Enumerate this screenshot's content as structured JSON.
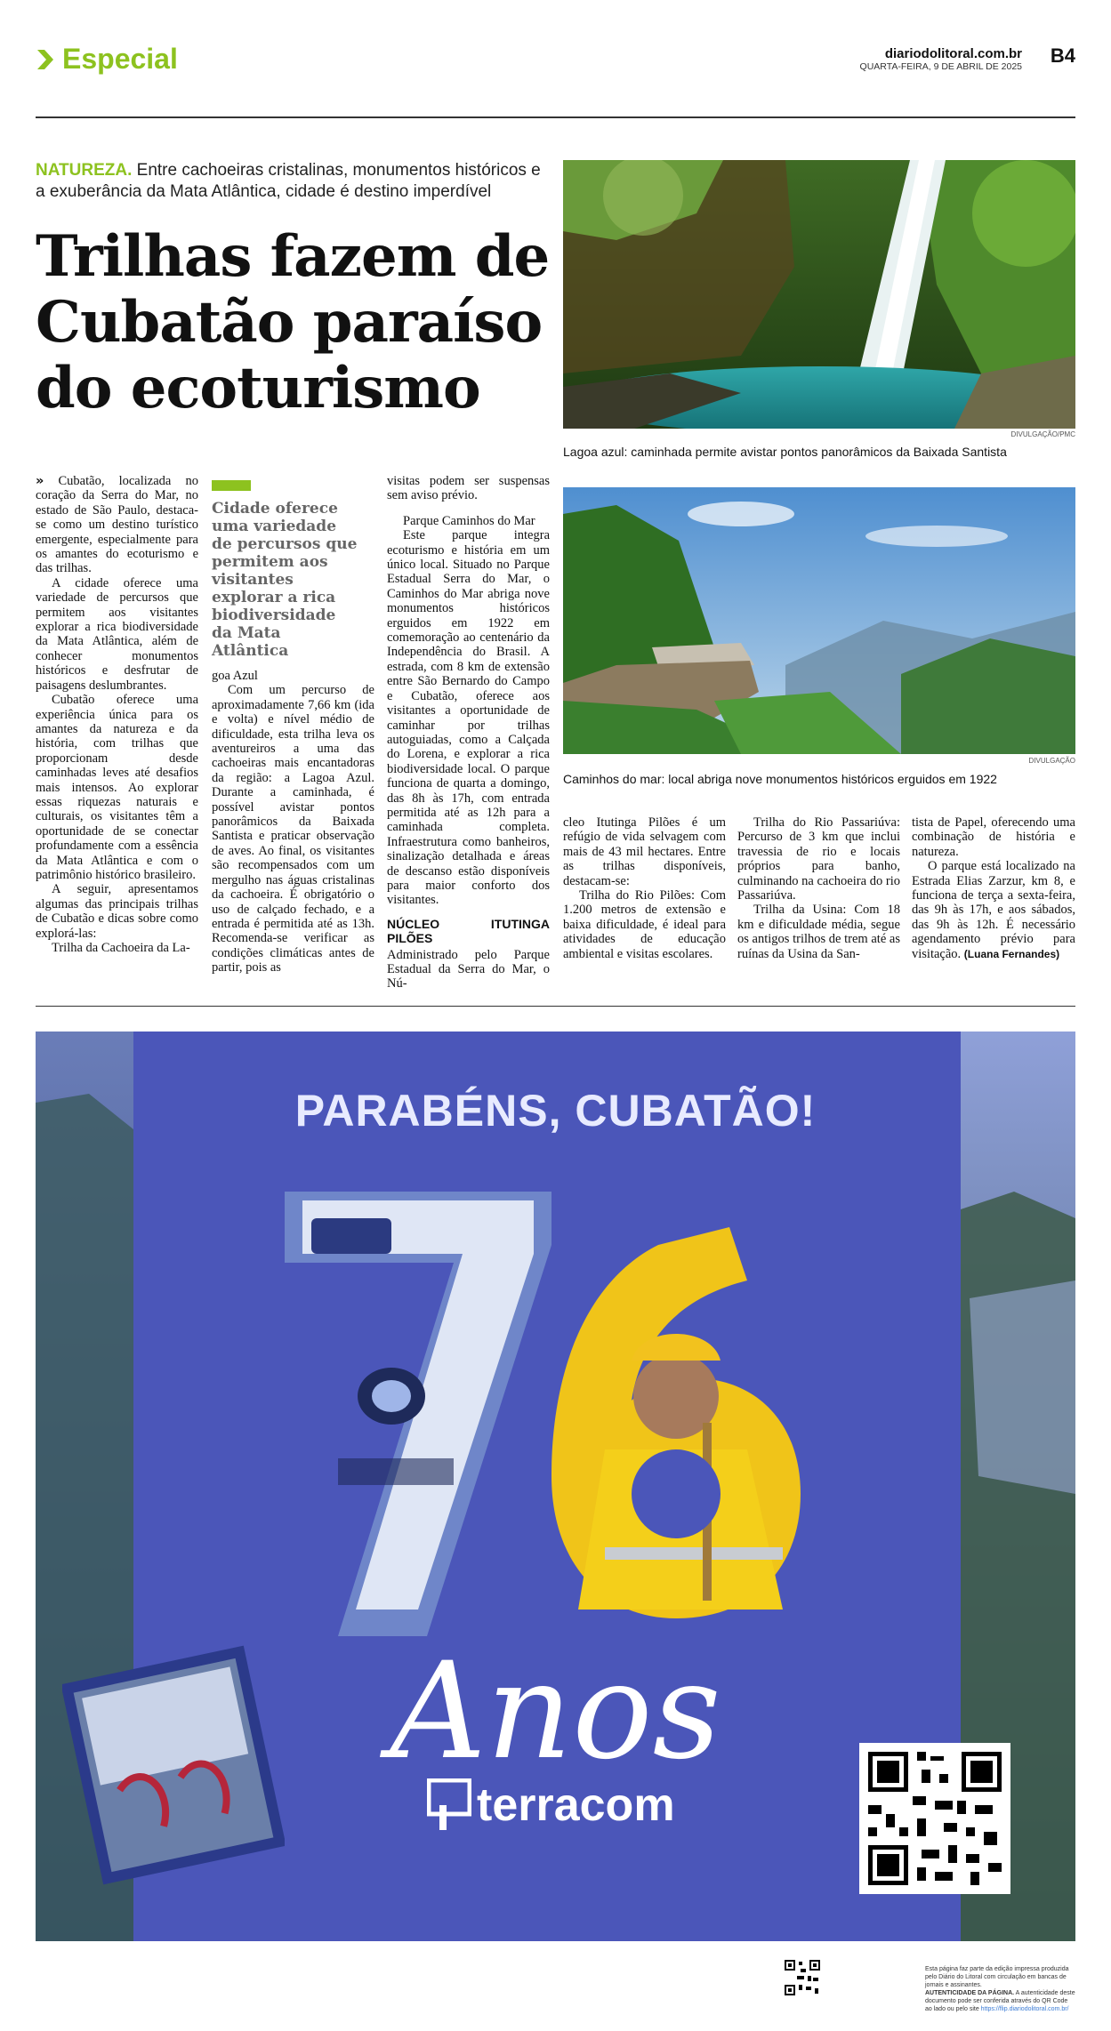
{
  "header": {
    "section": "Especial",
    "site": "diariodolitoral.com.br",
    "date": "QUARTA-FEIRA, 9 DE ABRIL DE 2025",
    "page": "B4"
  },
  "article": {
    "kicker_label": "NATUREZA.",
    "kicker_text": "Entre cachoeiras cristalinas, monumentos históricos e a exuberância da Mata Atlântica, cidade é destino imperdível",
    "headline": "Trilhas fazem de Cubatão paraíso do ecoturismo",
    "pullquote": "Cidade oferece uma variedade de percursos que permitem aos visitantes explorar a rica biodiversidade da Mata Atlântica",
    "col1": [
      "Cubatão, localizada no coração da Serra do Mar, no estado de São Paulo, destaca-se como um destino turístico emergente, especialmente para os amantes do ecoturismo e das trilhas.",
      "A cidade oferece uma variedade de percursos que permitem aos visitantes explorar a rica biodiversidade da Mata Atlântica, além de conhecer monumentos históricos e desfrutar de paisagens deslumbrantes.",
      "Cubatão oferece uma experiência única para os amantes da natureza e da história, com trilhas que proporcionam desde caminhadas leves até desafios mais intensos. Ao explorar essas riquezas naturais e culturais, os visitantes têm a oportunidade de se conectar profundamente com a essência da Mata Atlântica e com o patrimônio histórico brasileiro.",
      "A seguir, apresentamos algumas das principais trilhas de Cubatão e dicas sobre como explorá-las:",
      "Trilha da Cachoeira da La-"
    ],
    "col2": [
      "goa Azul",
      "Com um percurso de aproximadamente 7,66 km (ida e volta) e nível médio de dificuldade, esta trilha leva os aventureiros a uma das cachoeiras mais encantadoras da região: a Lagoa Azul. Durante a caminhada, é possível avistar pontos panorâmicos da Baixada Santista e praticar observação de aves. Ao final, os visitantes são recompensados com um mergulho nas águas cristalinas da cachoeira. É obrigatório o uso de calçado fechado, e a entrada é permitida até as 13h. Recomenda-se verificar as condições climáticas antes de partir, pois as"
    ],
    "col3": [
      "visitas podem ser suspensas sem aviso prévio.",
      "Parque Caminhos do Mar",
      "Este parque integra ecoturismo e história em um único local. Situado no Parque Estadual Serra do Mar, o Caminhos do Mar abriga nove monumentos históricos erguidos em 1922 em comemoração ao centenário da Independência do Brasil. A estrada, com 8 km de extensão entre São Bernardo do Campo e Cubatão, oferece aos visitantes a oportunidade de caminhar por trilhas autoguiadas, como a Calçada do Lorena, e explorar a rica biodiversidade local. O parque funciona de quarta a domingo, das 8h às 17h, com entrada permitida até as 12h para a caminhada completa. Infraestrutura como banheiros, sinalização detalhada e áreas de descanso estão disponíveis para maior conforto dos visitantes.",
      "NÚCLEO ITUTINGA PILÕES",
      "Administrado pelo Parque Estadual da Serra do Mar, o Nú-"
    ],
    "col4": [
      "cleo Itutinga Pilões é um refúgio de vida selvagem com mais de 43 mil hectares. Entre as trilhas disponíveis, destacam-se:",
      "Trilha do Rio Pilões: Com 1.200 metros de extensão e baixa dificuldade, é ideal para atividades de educação ambiental e visitas escolares."
    ],
    "col5": [
      "Trilha do Rio Passariúva: Percurso de 3 km que inclui travessia de rio e locais próprios para banho, culminando na cachoeira do rio Passariúva.",
      "Trilha da Usina: Com 18 km e dificuldade média, segue os antigos trilhos de trem até as ruínas da Usina da San-"
    ],
    "col6": [
      "tista de Papel, oferecendo uma combinação de história e natureza.",
      "O parque está localizado na Estrada Elias Zarzur, km 8, e funciona de terça a sexta-feira, das 9h às 17h, e aos sábados, das 9h às 12h. É necessário agendamento prévio para visitação."
    ],
    "signature": "(Luana Fernandes)"
  },
  "photos": {
    "photo1_credit": "DIVULGAÇÃO/PMC",
    "photo1_caption": "Lagoa azul: caminhada permite avistar pontos panorâmicos da Baixada Santista",
    "photo2_credit": "DIVULGAÇÃO",
    "photo2_caption": "Caminhos do mar: local abriga nove monumentos históricos erguidos em 1922"
  },
  "ad": {
    "title": "PARABÉNS, CUBATÃO!",
    "number": "76",
    "script": "Anos",
    "brand": "terracom"
  },
  "footer": {
    "line1": "Esta página faz parte da edição impressa produzida pelo Diário do Litoral com circulação em bancas de jornais e assinantes.",
    "auth_label": "AUTENTICIDADE DA PÁGINA.",
    "auth_text": "A autenticidade deste documento pode ser conferida através do QR Code ao lado ou pelo site",
    "auth_url": "https://flip.diariodolitoral.com.br/"
  },
  "colors": {
    "accent": "#8dc21f",
    "ad_blue": "#4a55b8"
  }
}
